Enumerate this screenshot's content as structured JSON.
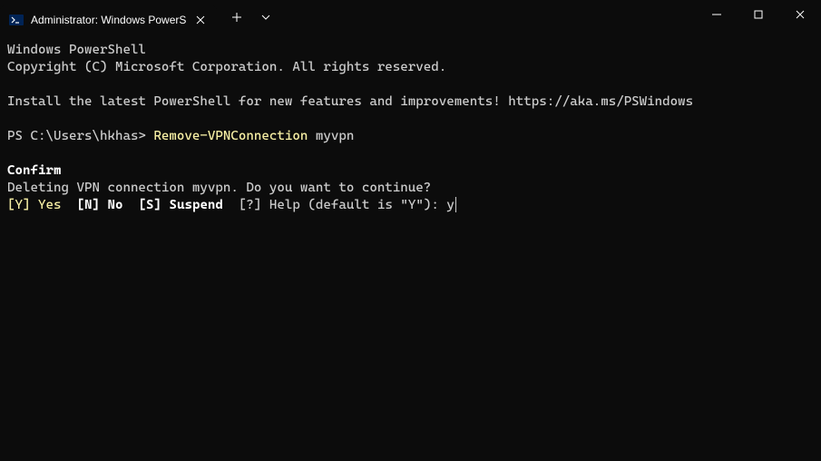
{
  "titlebar": {
    "tab_title": "Administrator: Windows PowerS"
  },
  "terminal": {
    "header1": "Windows PowerShell",
    "header2": "Copyright (C) Microsoft Corporation. All rights reserved.",
    "install_msg": "Install the latest PowerShell for new features and improvements! https://aka.ms/PSWindows",
    "prompt_prefix": "PS C:\\Users\\hkhas> ",
    "command": "Remove-VPNConnection",
    "command_arg": " myvpn",
    "confirm_title": "Confirm",
    "confirm_msg": "Deleting VPN connection myvpn. Do you want to continue?",
    "opt_yes": "[Y] Yes",
    "opt_no": "[N] No",
    "opt_suspend": "[S] Suspend",
    "opt_help": "[?] Help (default is \"Y\"): ",
    "user_input": "y"
  }
}
